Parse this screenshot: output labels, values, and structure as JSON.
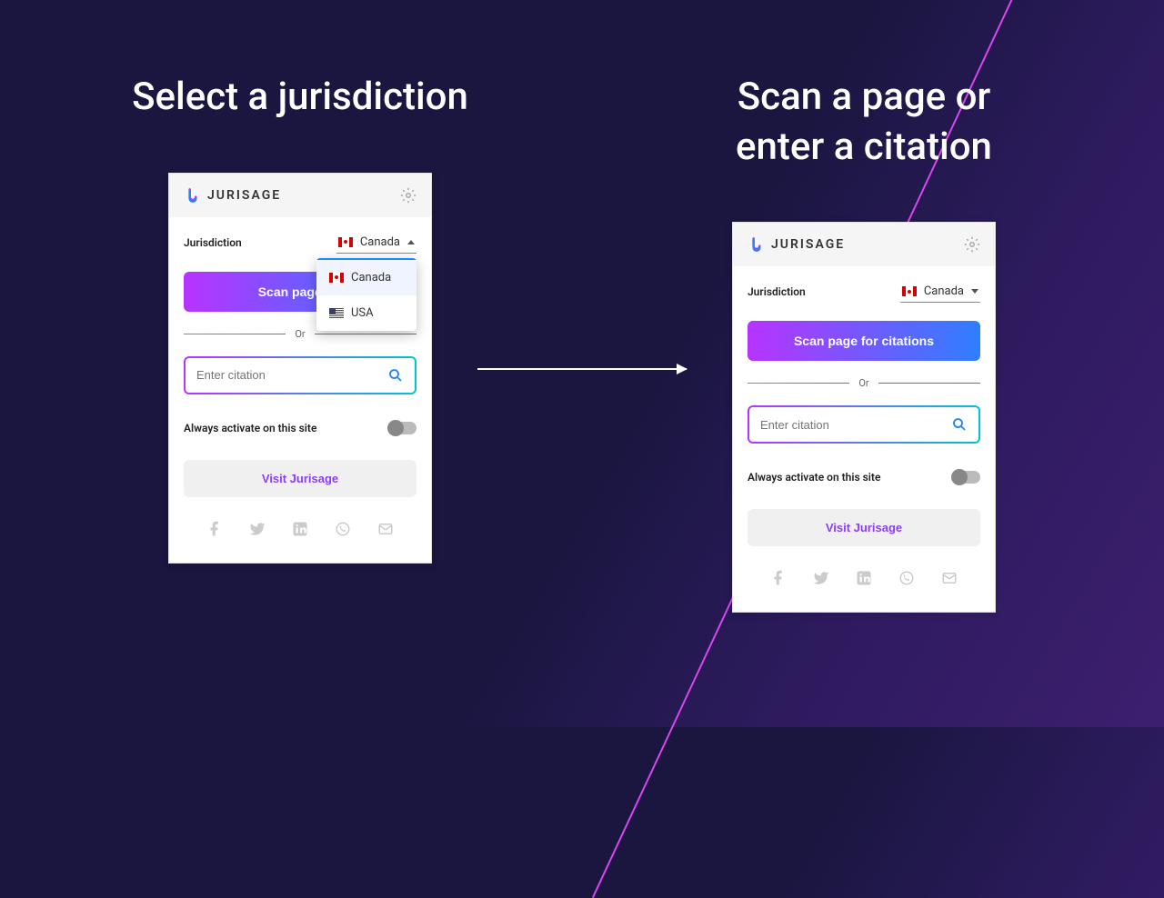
{
  "left": {
    "heading": "Select a jurisdiction",
    "popup": {
      "brand": "JURISAGE",
      "jurisdiction_label": "Jurisdiction",
      "selected": "Canada",
      "options": [
        "Canada",
        "USA"
      ],
      "scan_label": "Scan page for",
      "or_label": "Or",
      "citation_placeholder": "Enter citation",
      "activate_label": "Always activate on this site",
      "visit_label": "Visit Jurisage"
    }
  },
  "right": {
    "heading": "Scan a page or enter a citation",
    "popup": {
      "brand": "JURISAGE",
      "jurisdiction_label": "Jurisdiction",
      "selected": "Canada",
      "scan_label": "Scan page for citations",
      "or_label": "Or",
      "citation_placeholder": "Enter citation",
      "activate_label": "Always activate on this site",
      "visit_label": "Visit Jurisage"
    }
  }
}
